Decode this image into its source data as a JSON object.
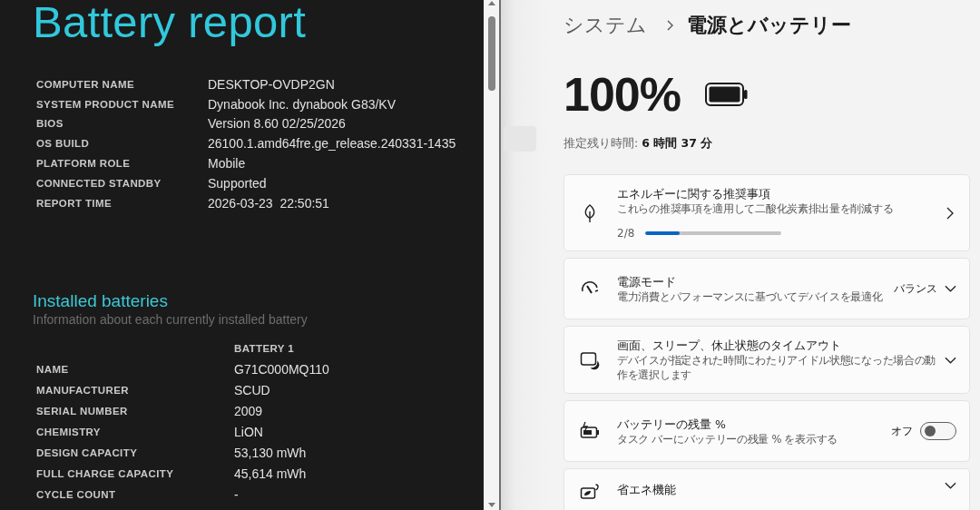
{
  "report": {
    "title": "Battery report",
    "system_info": [
      {
        "label": "COMPUTER NAME",
        "value": "DESKTOP-OVDP2GN"
      },
      {
        "label": "SYSTEM PRODUCT NAME",
        "value": "Dynabook Inc. dynabook G83/KV"
      },
      {
        "label": "BIOS",
        "value": "Version 8.60 02/25/2026"
      },
      {
        "label": "OS BUILD",
        "value": "26100.1.amd64fre.ge_release.240331-1435"
      },
      {
        "label": "PLATFORM ROLE",
        "value": "Mobile"
      },
      {
        "label": "CONNECTED STANDBY",
        "value": "Supported"
      },
      {
        "label": "REPORT TIME",
        "value": "2026-03-23  22:50:51"
      }
    ],
    "installed_batteries": {
      "heading": "Installed batteries",
      "subtitle": "Information about each currently installed battery",
      "column_header": "BATTERY 1",
      "rows": [
        {
          "label": "NAME",
          "value": "G71C000MQ110"
        },
        {
          "label": "MANUFACTURER",
          "value": "SCUD"
        },
        {
          "label": "SERIAL NUMBER",
          "value": "2009"
        },
        {
          "label": "CHEMISTRY",
          "value": "LiON"
        },
        {
          "label": "DESIGN CAPACITY",
          "value": "53,130 mWh"
        },
        {
          "label": "FULL CHARGE CAPACITY",
          "value": "45,614 mWh"
        },
        {
          "label": "CYCLE COUNT",
          "value": "-"
        }
      ]
    }
  },
  "settings": {
    "breadcrumb": {
      "parent": "システム",
      "current": "電源とバッテリー"
    },
    "charge_percent": "100%",
    "remaining": "推定残り時間: **6 時間 37 分**",
    "cards": [
      {
        "kind": "progress",
        "title": "エネルギーに関する推奨事項",
        "description": "これらの推奨事項を適用して二酸化炭素排出量を削減する",
        "progress_text": "2/8",
        "level": 0.25
      },
      {
        "kind": "dropdown",
        "title": "電源モード",
        "description": "電力消費とパフォーマンスに基づいてデバイスを最適化",
        "value": "バランス"
      },
      {
        "kind": "expander",
        "title": "画面、スリープ、休止状態のタイムアウト",
        "description": "デバイスが指定された時間にわたりアイドル状態になった場合の動作を選択します"
      },
      {
        "kind": "toggle",
        "title": "バッテリーの残量 %",
        "description": "タスク バーにバッテリーの残量 % を表示する",
        "state_text": "オフ",
        "on": false
      },
      {
        "kind": "expander",
        "title": "省エネ機能"
      }
    ]
  }
}
